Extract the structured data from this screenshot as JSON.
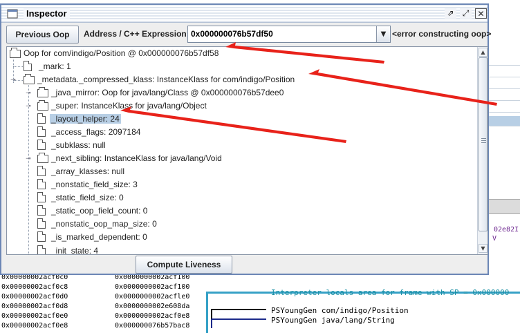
{
  "window": {
    "title": "Inspector",
    "controls": [
      "⇗",
      "⤢",
      "✕"
    ]
  },
  "toolbar": {
    "previous_label": "Previous Oop",
    "expression_label": "Address / C++ Expression:",
    "expression_value": "0x000000076b57df50",
    "error_text": "<error constructing oop>"
  },
  "tree": {
    "nodes": [
      {
        "label": "Oop for com/indigo/Position @ 0x000000076b57df58",
        "kind": "folder",
        "depth": 0
      },
      {
        "label": "_mark: 1",
        "kind": "file",
        "depth": 1
      },
      {
        "label": "_metadata._compressed_klass: InstanceKlass for com/indigo/Position",
        "kind": "folder",
        "depth": 1
      },
      {
        "label": "_java_mirror: Oop for java/lang/Class @ 0x000000076b57dee0",
        "kind": "folder",
        "depth": 2
      },
      {
        "label": "_super: InstanceKlass for java/lang/Object",
        "kind": "folder",
        "depth": 2
      },
      {
        "label": "_layout_helper: 24",
        "kind": "file",
        "depth": 2,
        "selected": true
      },
      {
        "label": "_access_flags: 2097184",
        "kind": "file",
        "depth": 2
      },
      {
        "label": "_subklass: null",
        "kind": "file",
        "depth": 2
      },
      {
        "label": "_next_sibling: InstanceKlass for java/lang/Void",
        "kind": "folder",
        "depth": 2
      },
      {
        "label": "_array_klasses: null",
        "kind": "file",
        "depth": 2
      },
      {
        "label": "_nonstatic_field_size: 3",
        "kind": "file",
        "depth": 2
      },
      {
        "label": "_static_field_size: 0",
        "kind": "file",
        "depth": 2
      },
      {
        "label": "_static_oop_field_count: 0",
        "kind": "file",
        "depth": 2
      },
      {
        "label": "_nonstatic_oop_map_size: 0",
        "kind": "file",
        "depth": 2
      },
      {
        "label": "_is_marked_dependent: 0",
        "kind": "file",
        "depth": 2
      },
      {
        "label": "_init_state: 4",
        "kind": "file",
        "depth": 2
      }
    ]
  },
  "compute_label": "Compute Liveness",
  "background": {
    "purple_right": [
      "02e82I",
      "V"
    ],
    "memory_rows": [
      {
        "addr": "0x00000002acf0c0",
        "val": "0x0000000002acf100"
      },
      {
        "addr": "0x00000002acf0c8",
        "val": "0x0000000002acf100"
      },
      {
        "addr": "0x00000002acf0d0",
        "val": "0x0000000002acfle0"
      },
      {
        "addr": "0x00000002acf0d8",
        "val": "0x0000000002e608da"
      },
      {
        "addr": "0x00000002acf0e0",
        "val": "0x0000000002acf0e8"
      },
      {
        "addr": "0x00000002acf0e8",
        "val": "0x000000076b57bac8"
      }
    ],
    "interp_text": "Interpreter locals area for frame with SP = 0x000000",
    "young_1": "PSYoungGen com/indigo/Position",
    "young_2": "PSYoungGen java/lang/String"
  },
  "colors": {
    "window_border": "#6b86b5",
    "selection": "#b8cfe5",
    "annotation_arrow": "#e8221a",
    "interp_text": "#1a8fa3",
    "purple_text": "#6b238e"
  }
}
